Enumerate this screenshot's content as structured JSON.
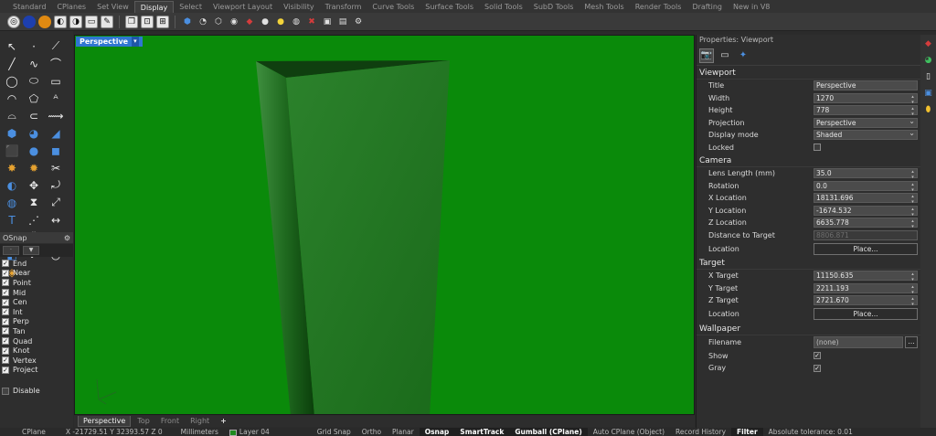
{
  "tabs": [
    "Standard",
    "CPlanes",
    "Set View",
    "Display",
    "Select",
    "Viewport Layout",
    "Visibility",
    "Transform",
    "Curve Tools",
    "Surface Tools",
    "Solid Tools",
    "SubD Tools",
    "Mesh Tools",
    "Render Tools",
    "Drafting",
    "New in V8"
  ],
  "active_tab": "Display",
  "viewport": {
    "label": "Perspective",
    "label_arrow": "▾",
    "background": "#0a8a0a"
  },
  "viewport_tabs": [
    "Perspective",
    "Top",
    "Front",
    "Right",
    "+"
  ],
  "osnap": {
    "title": "OSnap",
    "items": [
      {
        "label": "End",
        "checked": true
      },
      {
        "label": "Near",
        "checked": true
      },
      {
        "label": "Point",
        "checked": true
      },
      {
        "label": "Mid",
        "checked": true
      },
      {
        "label": "Cen",
        "checked": true
      },
      {
        "label": "Int",
        "checked": true
      },
      {
        "label": "Perp",
        "checked": true
      },
      {
        "label": "Tan",
        "checked": true
      },
      {
        "label": "Quad",
        "checked": true
      },
      {
        "label": "Knot",
        "checked": true
      },
      {
        "label": "Vertex",
        "checked": true
      },
      {
        "label": "Project",
        "checked": true
      }
    ],
    "disable_label": "Disable"
  },
  "properties": {
    "title": "Properties: Viewport",
    "viewport_section": "Viewport",
    "title_label": "Title",
    "title_value": "Perspective",
    "width_label": "Width",
    "width_value": "1270",
    "height_label": "Height",
    "height_value": "778",
    "projection_label": "Projection",
    "projection_value": "Perspective",
    "display_mode_label": "Display mode",
    "display_mode_value": "Shaded",
    "locked_label": "Locked",
    "camera_section": "Camera",
    "lens_label": "Lens Length (mm)",
    "lens_value": "35.0",
    "rotation_label": "Rotation",
    "rotation_value": "0.0",
    "xloc_label": "X Location",
    "xloc_value": "18131.696",
    "yloc_label": "Y Location",
    "yloc_value": "-1674.532",
    "zloc_label": "Z Location",
    "zloc_value": "6635.778",
    "dist_label": "Distance to Target",
    "dist_value": "8806.871",
    "cam_location_label": "Location",
    "place_label": "Place...",
    "target_section": "Target",
    "xt_label": "X Target",
    "xt_value": "11150.635",
    "yt_label": "Y Target",
    "yt_value": "2211.193",
    "zt_label": "Z Target",
    "zt_value": "2721.670",
    "target_location_label": "Location",
    "wallpaper_section": "Wallpaper",
    "filename_label": "Filename",
    "filename_value": "(none)",
    "browse_label": "...",
    "show_label": "Show",
    "gray_label": "Gray"
  },
  "status": {
    "cplane": "CPlane",
    "coords": "X -21729.51  Y 32393.57  Z 0",
    "units": "Millimeters",
    "layer": "Layer 04",
    "grid_snap": "Grid Snap",
    "ortho": "Ortho",
    "planar": "Planar",
    "osnap": "Osnap",
    "smarttrack": "SmartTrack",
    "gumball": "Gumball (CPlane)",
    "auto_cplane": "Auto CPlane (Object)",
    "record_history": "Record History",
    "filter": "Filter",
    "tolerance": "Absolute tolerance: 0.01"
  }
}
